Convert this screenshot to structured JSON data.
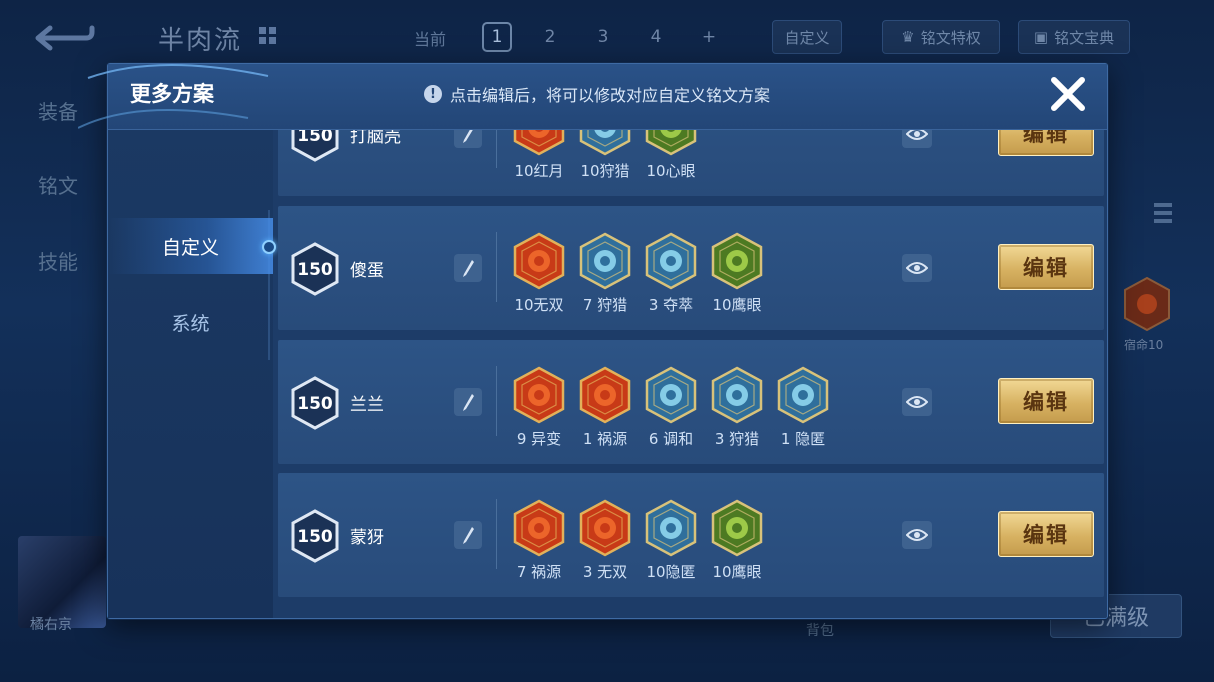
{
  "background": {
    "title": "半肉流",
    "tabs": {
      "current": "当前",
      "slots": [
        "1",
        "2",
        "3",
        "4",
        "+"
      ],
      "active_slot": "1",
      "custom": "自定义"
    },
    "privilege_btn": "铭文特权",
    "codex_btn": "铭文宝典",
    "side_items": [
      "装备",
      "铭文",
      "技能"
    ],
    "hero_name": "橘右京",
    "bag": "背包",
    "full_level_btn": "已满级",
    "right_rune_label": "宿命10"
  },
  "modal": {
    "title": "更多方案",
    "notice": "点击编辑后，将可以修改对应自定义铭文方案",
    "nav": [
      "自定义",
      "系统"
    ],
    "edit_label": "编辑",
    "rows": [
      {
        "level": "150",
        "name": "打脑壳",
        "runes": [
          {
            "label": "10红月",
            "color": "red"
          },
          {
            "label": "10狩猎",
            "color": "blue"
          },
          {
            "label": "10心眼",
            "color": "green"
          }
        ]
      },
      {
        "level": "150",
        "name": "傻蛋",
        "runes": [
          {
            "label": "10无双",
            "color": "red"
          },
          {
            "label": "7 狩猎",
            "color": "blue"
          },
          {
            "label": "3 夺萃",
            "color": "blue"
          },
          {
            "label": "10鹰眼",
            "color": "green"
          }
        ]
      },
      {
        "level": "150",
        "name": "兰兰",
        "runes": [
          {
            "label": "9 异变",
            "color": "red"
          },
          {
            "label": "1 祸源",
            "color": "red"
          },
          {
            "label": "6 调和",
            "color": "blue"
          },
          {
            "label": "3 狩猎",
            "color": "blue"
          },
          {
            "label": "1 隐匿",
            "color": "blue"
          }
        ]
      },
      {
        "level": "150",
        "name": "蒙犽",
        "runes": [
          {
            "label": "7 祸源",
            "color": "red"
          },
          {
            "label": "3 无双",
            "color": "red"
          },
          {
            "label": "10隐匿",
            "color": "blue"
          },
          {
            "label": "10鹰眼",
            "color": "green"
          }
        ]
      }
    ]
  },
  "colors": {
    "red_rune": "#d8481f",
    "blue_rune": "#5fb4d8",
    "green_rune": "#7fb23a",
    "gold_button": "#d7b262"
  }
}
